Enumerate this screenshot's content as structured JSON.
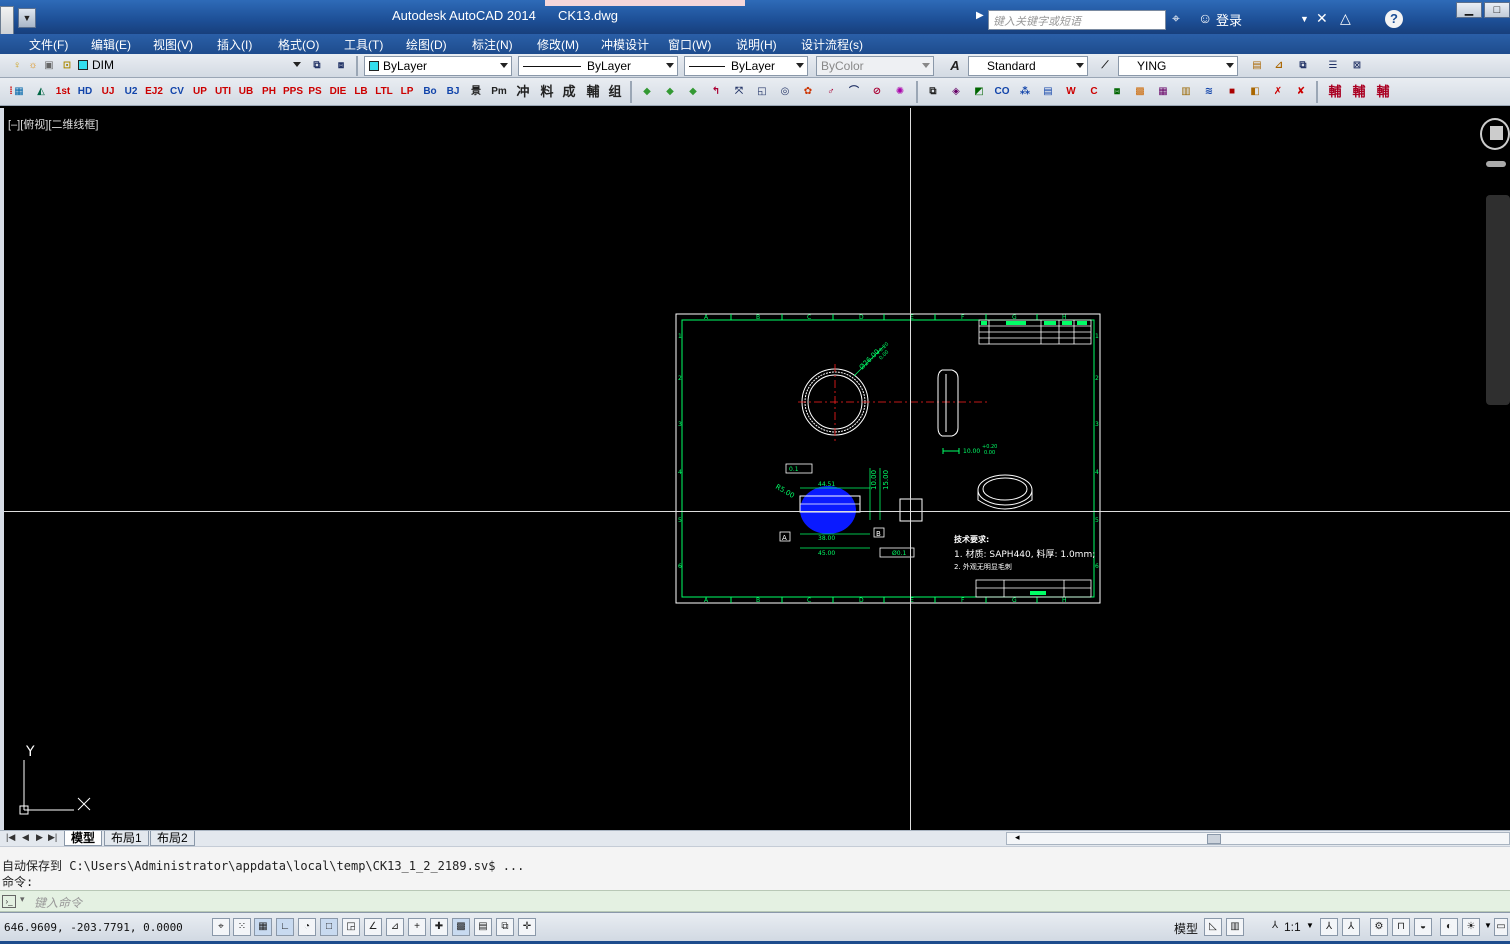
{
  "window": {
    "app_title": "Autodesk AutoCAD 2014",
    "file_name": "CK13.dwg",
    "search_placeholder": "键入关键字或短语",
    "login_label": "登录",
    "minimize": "▁",
    "maximize": "□",
    "help": "?"
  },
  "menu": [
    {
      "label": "文件(F)"
    },
    {
      "label": "编辑(E)"
    },
    {
      "label": "视图(V)"
    },
    {
      "label": "插入(I)"
    },
    {
      "label": "格式(O)"
    },
    {
      "label": "工具(T)"
    },
    {
      "label": "绘图(D)"
    },
    {
      "label": "标注(N)"
    },
    {
      "label": "修改(M)"
    },
    {
      "label": "冲模设计"
    },
    {
      "label": "窗口(W)"
    },
    {
      "label": "说明(H)"
    },
    {
      "label": "设计流程(s)"
    }
  ],
  "toolbar1": {
    "layer_name": "DIM",
    "color": "ByLayer",
    "linetype": "ByLayer",
    "lineweight": "ByLayer",
    "plotstyle": "ByColor",
    "text_style": "Standard",
    "dim_style": "YING"
  },
  "toolbar2": {
    "left_icons": [
      "1st",
      "HD",
      "UJ",
      "U2",
      "EJ2",
      "CV",
      "UP",
      "UTI",
      "UB",
      "PH",
      "PPS",
      "PS",
      "DIE",
      "LB",
      "LTL",
      "LP",
      "Bo",
      "BJ",
      "景",
      "Pm",
      "冲",
      "料",
      "成",
      "輔",
      "组"
    ],
    "right_icons": [
      "輔",
      "輔",
      "輔"
    ]
  },
  "viewport": {
    "label": "[–][俯视][二维线框]"
  },
  "drawing": {
    "dim_diameter": "Ø26.00",
    "dim_tol_upper": "+0.20",
    "dim_tol_lower": "0.00",
    "dim_width": "10.00",
    "dim_44": "44.51",
    "dim_38": "38.00",
    "dim_45": "45.00",
    "dim_10": "10.00",
    "dim_15": "15.00",
    "dim_r5": "R5.00",
    "flatness": "0.1",
    "datum_a": "A",
    "datum_b": "B",
    "position_tol": "Ø0.1",
    "tech_title": "技术要求:",
    "tech_line1": "1. 材质: SAPH440, 料厚: 1.0mm;",
    "tech_line2": "2. 外观无明显毛刺"
  },
  "ucs": {
    "y_label": "Y",
    "x_label": "X"
  },
  "tabs": {
    "model": "模型",
    "layout1": "布局1",
    "layout2": "布局2"
  },
  "command": {
    "history1": "自动保存到 C:\\Users\\Administrator\\appdata\\local\\temp\\CK13_1_2_2189.sv$ ...",
    "history2": "命令:",
    "placeholder": "键入命令"
  },
  "status": {
    "coords": "646.9609, -203.7791, 0.0000",
    "model_label": "模型",
    "scale": "1:1"
  },
  "colors": {
    "titlebar": "#1d4f96",
    "drawing_bg": "#000000",
    "geometry": "#ffffff",
    "dimension": "#00ff66",
    "centerline": "#ff2020",
    "hatch": "#0a1aff",
    "frame": "#00ff66"
  }
}
